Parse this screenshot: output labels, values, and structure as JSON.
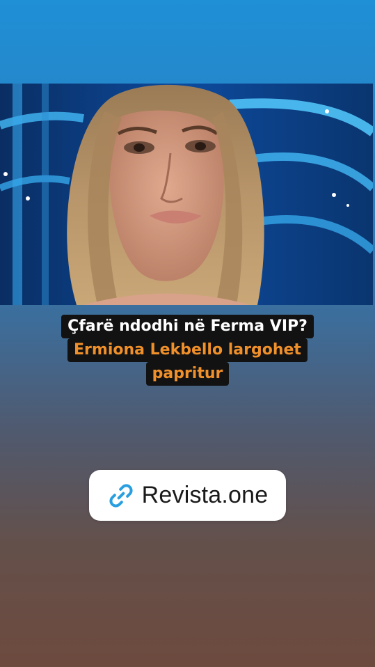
{
  "story": {
    "headline": {
      "line1": "Çfarë ndodhi në Ferma VIP?",
      "line2": "Ermiona Lekbello largohet",
      "line3": "papritur"
    },
    "link_sticker": {
      "icon": "link-icon",
      "text": "Revista.one"
    }
  },
  "colors": {
    "background_top": "#1f8fd6",
    "background_bottom": "#6d4a3e",
    "headline_white": "#ffffff",
    "headline_orange": "#f0902a",
    "headline_box": "#121212",
    "link_icon": "#2a9fe0"
  }
}
